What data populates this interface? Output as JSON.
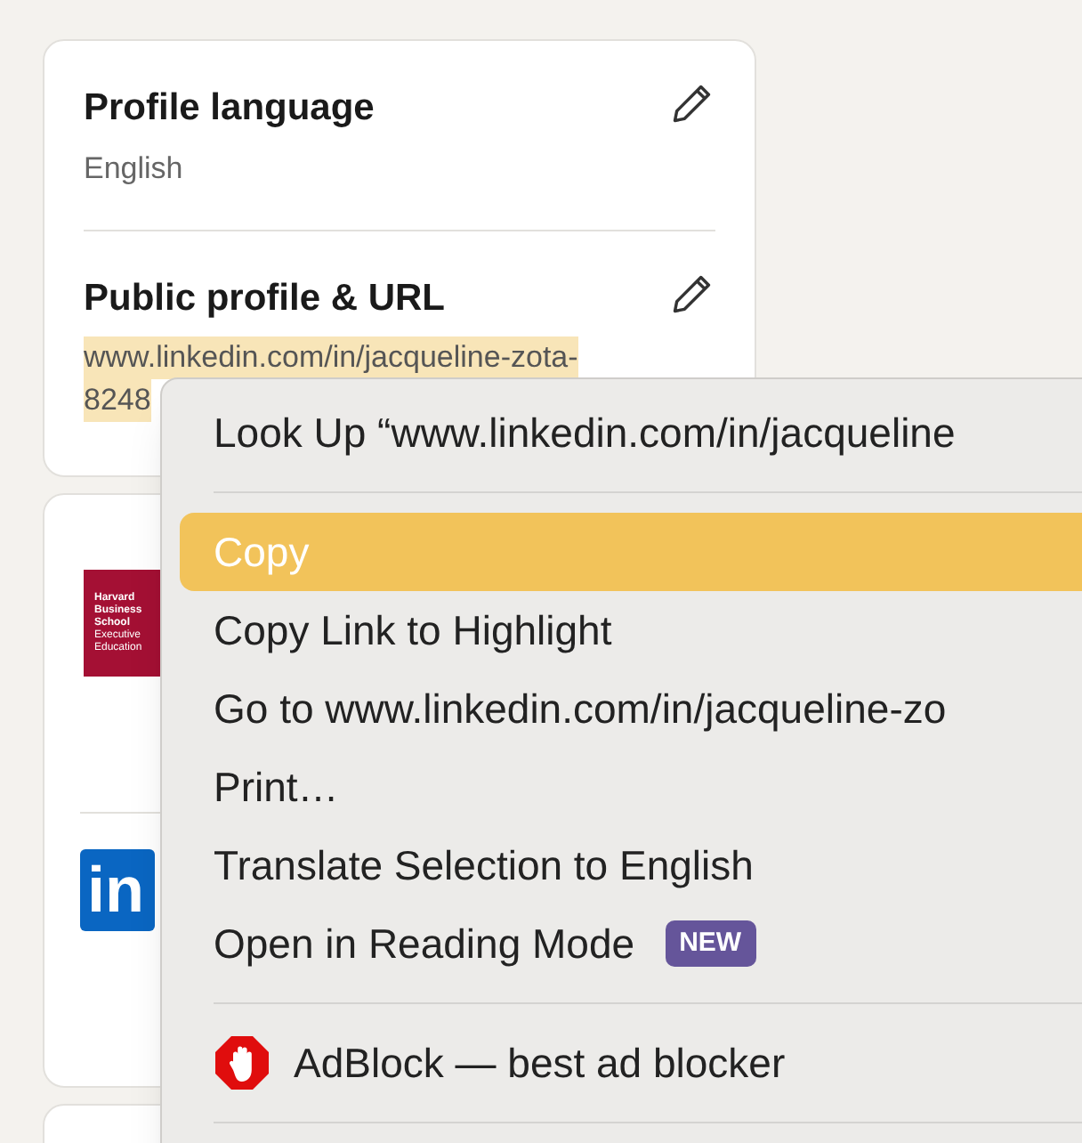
{
  "profile_card": {
    "sections": [
      {
        "title": "Profile language",
        "value_lines": [
          "English"
        ],
        "highlighted": false
      },
      {
        "title": "Public profile & URL",
        "value_lines": [
          "www.linkedin.com/in/jacqueline-zota-",
          "8248"
        ],
        "highlighted": true
      }
    ]
  },
  "education_card": {
    "logos": [
      {
        "kind": "school",
        "lines": [
          "Harvard",
          "Business",
          "School",
          "Executive",
          "Education"
        ]
      },
      {
        "kind": "brand",
        "lines": [
          "in"
        ]
      }
    ]
  },
  "context_menu": {
    "items": [
      {
        "kind": "item",
        "label": "Look Up “www.linkedin.com/in/jacqueline",
        "selected": false
      },
      {
        "kind": "separator"
      },
      {
        "kind": "item",
        "label": "Copy",
        "selected": true
      },
      {
        "kind": "item",
        "label": "Copy Link to Highlight",
        "selected": false
      },
      {
        "kind": "item",
        "label": "Go to www.linkedin.com/in/jacqueline-zo",
        "selected": false
      },
      {
        "kind": "item",
        "label": "Print…",
        "selected": false
      },
      {
        "kind": "item",
        "label": "Translate Selection to English",
        "selected": false
      },
      {
        "kind": "item",
        "label": "Open in Reading Mode",
        "badge": "NEW",
        "selected": false
      },
      {
        "kind": "separator"
      },
      {
        "kind": "extension",
        "label": "AdBlock — best ad blocker",
        "selected": false
      },
      {
        "kind": "separator"
      }
    ]
  }
}
